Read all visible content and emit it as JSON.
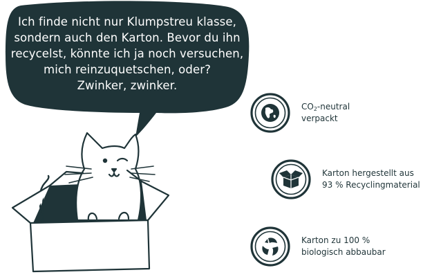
{
  "speech_bubble": {
    "lines": [
      "Ich finde nicht nur Klumpstreu klasse,",
      "sondern auch den Karton. Bevor du ihn",
      "recycelst, könnte ich ja noch versuchen,",
      "mich reinzuquetschen, oder?",
      "Zwinker, zwinker."
    ]
  },
  "features": [
    {
      "icon": "globe-icon",
      "line1_pre": "CO",
      "line1_sub": "2",
      "line1_post": "-neutral",
      "line2": "verpackt"
    },
    {
      "icon": "open-box-icon",
      "line1": "Karton hergestellt aus",
      "line2": "93 % Recyclingmaterial"
    },
    {
      "icon": "recycle-leaves-icon",
      "line1": "Karton zu 100 %",
      "line2": "biologisch abbaubar"
    }
  ],
  "colors": {
    "dark": "#1f3438",
    "background": "#ffffff"
  }
}
